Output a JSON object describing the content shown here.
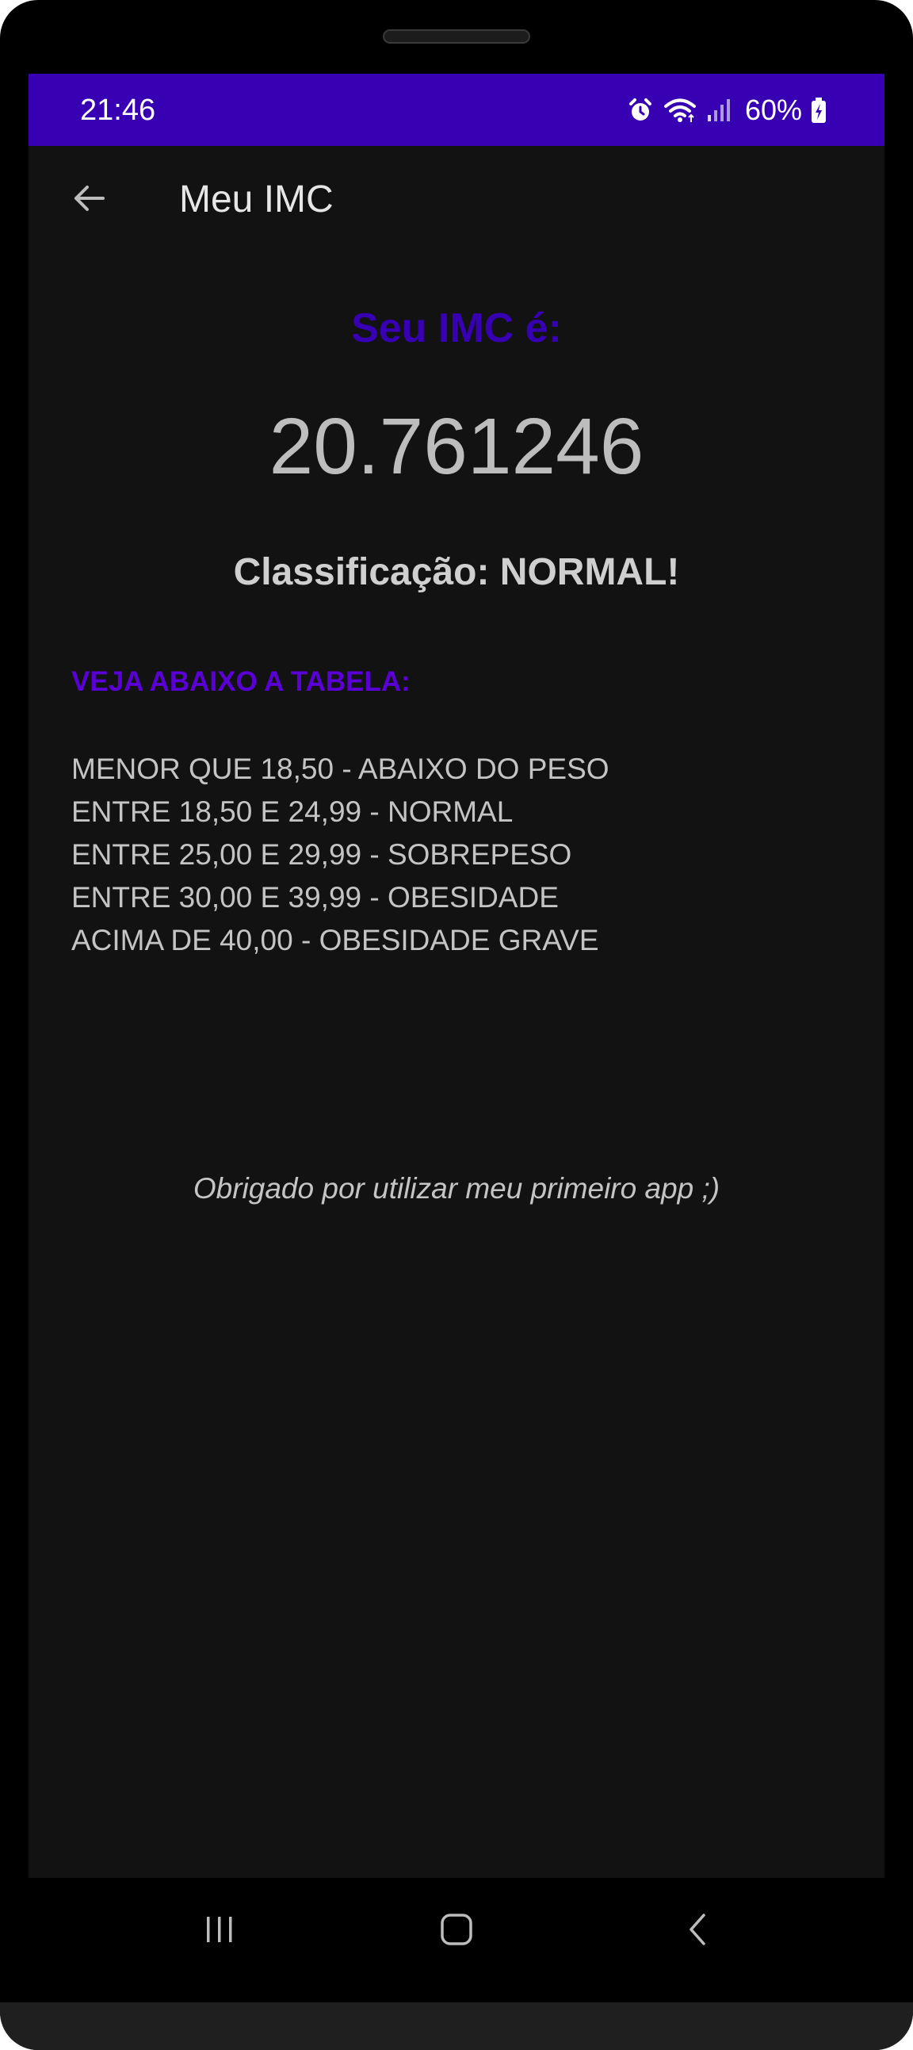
{
  "status_bar": {
    "time": "21:46",
    "battery_percent": "60%",
    "icons": [
      "alarm-icon",
      "wifi-icon",
      "cell-signal-icon",
      "battery-charging-icon"
    ],
    "background_color": "#3700b3"
  },
  "app_bar": {
    "title": "Meu IMC",
    "back_icon": "arrow-back-icon"
  },
  "result": {
    "label": "Seu IMC é:",
    "value": "20.761246",
    "classification": "Classificação: NORMAL!"
  },
  "table": {
    "heading": "VEJA ABAIXO A TABELA:",
    "rows": [
      "MENOR QUE 18,50 - ABAIXO DO PESO",
      "ENTRE 18,50 E 24,99 - NORMAL",
      "ENTRE 25,00 E 29,99 - SOBREPESO",
      "ENTRE 30,00 E 39,99 - OBESIDADE",
      "ACIMA DE 40,00 - OBESIDADE GRAVE"
    ]
  },
  "footer": {
    "thanks": "Obrigado por utilizar meu primeiro app ;)"
  },
  "navigation_bar": {
    "buttons": [
      "recents-icon",
      "home-icon",
      "back-icon"
    ]
  },
  "colors": {
    "primary": "#3700b3",
    "accent": "#5a00d6",
    "background": "#121212",
    "text": "#c4c4c4"
  }
}
